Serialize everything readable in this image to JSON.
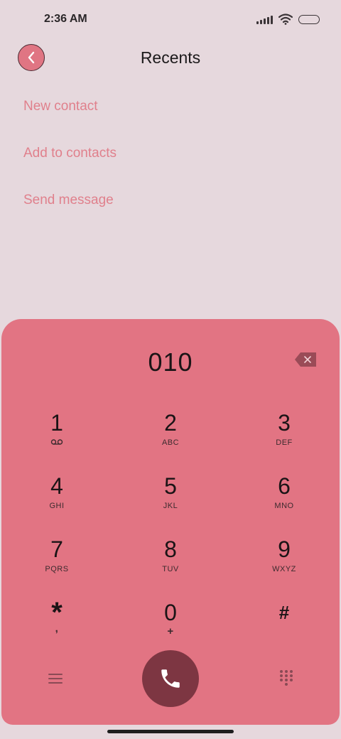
{
  "status_bar": {
    "time": "2:36 AM",
    "icons": [
      "signal-icon",
      "wifi-icon",
      "battery-icon"
    ]
  },
  "header": {
    "title": "Recents",
    "back_icon": "back-icon"
  },
  "menu": {
    "items": [
      {
        "label": "New contact"
      },
      {
        "label": "Add to contacts"
      },
      {
        "label": "Send message"
      }
    ]
  },
  "dialer": {
    "number": "010",
    "backspace_icon": "backspace-icon",
    "keys": [
      {
        "digit": "1",
        "letters": ""
      },
      {
        "digit": "2",
        "letters": "ABC"
      },
      {
        "digit": "3",
        "letters": "DEF"
      },
      {
        "digit": "4",
        "letters": "GHI"
      },
      {
        "digit": "5",
        "letters": "JKL"
      },
      {
        "digit": "6",
        "letters": "MNO"
      },
      {
        "digit": "7",
        "letters": "PQRS"
      },
      {
        "digit": "8",
        "letters": "TUV"
      },
      {
        "digit": "9",
        "letters": "WXYZ"
      },
      {
        "digit": "*",
        "letters": ","
      },
      {
        "digit": "0",
        "letters": "+"
      },
      {
        "digit": "#",
        "letters": ""
      }
    ],
    "bottom": {
      "menu_icon": "menu-icon",
      "call_icon": "phone-icon",
      "dialpad_icon": "dialpad-icon"
    }
  },
  "colors": {
    "background": "#e6d8dd",
    "accent": "#e27483",
    "call_button": "#7d3642",
    "link_text": "#e0808c"
  }
}
